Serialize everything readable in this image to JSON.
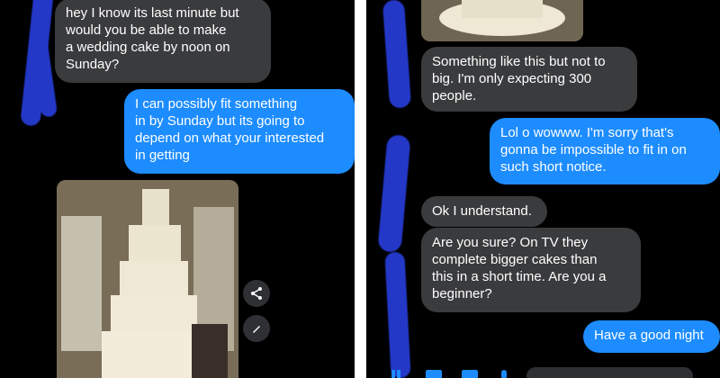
{
  "left_chat": {
    "messages": [
      {
        "type": "received",
        "text": "hey I know its last minute but\nwould you be able to make\na wedding cake by noon on\nSunday?"
      },
      {
        "type": "sent",
        "text": "I can possibly fit something\nin by Sunday but its going to\ndepend on what your interested\nin getting"
      }
    ],
    "actions": [
      "share-icon",
      "edit-icon"
    ]
  },
  "right_chat": {
    "messages": [
      {
        "type": "received",
        "text": "Something like this but not to\nbig. I'm only expecting 300\npeople."
      },
      {
        "type": "sent",
        "text": "Lol o wowww. I'm sorry that's\ngonna be impossible to fit in on\nsuch short notice."
      },
      {
        "type": "received",
        "text": "Ok I understand."
      },
      {
        "type": "received",
        "text": "Are you sure?   On TV they\ncomplete bigger cakes than\nthis in a short time. Are you a\nbeginner?"
      },
      {
        "type": "sent",
        "text": "Have a good night"
      }
    ]
  },
  "colors": {
    "background": "#000000",
    "received_bubble": "#3a3b3d",
    "sent_bubble": "#1d8cff",
    "redaction": "#2438c8"
  }
}
